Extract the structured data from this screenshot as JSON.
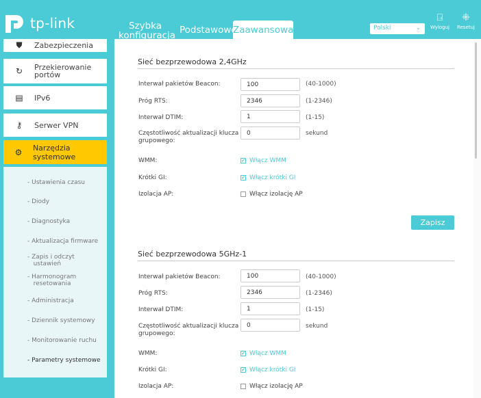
{
  "header": {
    "logo_text": "tp-link",
    "tabs": {
      "quick_line1": "Szybka",
      "quick_line2": "konfiguracja",
      "basic": "Podstawowe",
      "advanced": "Zaawansowane"
    },
    "language": "Polski",
    "logout": "Wyloguj",
    "reset": "Resetuj"
  },
  "sidebar": {
    "items": [
      {
        "label": "Zabezpieczenia",
        "icon": "shield-icon"
      },
      {
        "label_line1": "Przekierowanie",
        "label_line2": "portów",
        "icon": "refresh-icon"
      },
      {
        "label": "IPv6",
        "icon": "ipv6-icon"
      },
      {
        "label": "Serwer VPN",
        "icon": "vpn-key-icon"
      },
      {
        "label": "Narzędzia systemowe",
        "icon": "gear-icon"
      }
    ],
    "submenu": [
      {
        "label": "Ustawienia czasu"
      },
      {
        "label": "Diody"
      },
      {
        "label": "Diagnostyka"
      },
      {
        "label": "Aktualizacja firmware"
      },
      {
        "label_line1": "Zapis i odczyt",
        "label_line2": "ustawień"
      },
      {
        "label_line1": "Harmonogram",
        "label_line2": "resetowania"
      },
      {
        "label": "Administracja"
      },
      {
        "label": "Dziennik systemowy"
      },
      {
        "label": "Monitorowanie ruchu"
      },
      {
        "label": "Parametry systemowe"
      }
    ],
    "submenu_prefix": "-"
  },
  "sections": [
    {
      "title": "Sieć bezprzewodowa 2,4GHz",
      "beacon": {
        "label": "Interwał pakietów Beacon:",
        "value": "100",
        "hint": "(40-1000)"
      },
      "rts": {
        "label": "Próg RTS:",
        "value": "2346",
        "hint": "(1-2346)"
      },
      "dtim": {
        "label": "Interwał DTIM:",
        "value": "1",
        "hint": "(1-15)"
      },
      "gkey": {
        "label_line1": "Częstotliwość aktualizacji klucza",
        "label_line2": "grupowego:",
        "value": "0",
        "hint": "sekund"
      },
      "wmm": {
        "label": "WMM:",
        "option": "Włącz WMM"
      },
      "sgi": {
        "label": "Krótki GI:",
        "option": "Włącz krótki GI"
      },
      "ap": {
        "label": "Izolacja AP:",
        "option": "Włącz izolację AP"
      }
    },
    {
      "title": "Sieć bezprzewodowa 5GHz-1",
      "beacon": {
        "label": "Interwał pakietów Beacon:",
        "value": "100",
        "hint": "(40-1000)"
      },
      "rts": {
        "label": "Próg RTS:",
        "value": "2346",
        "hint": "(1-2346)"
      },
      "dtim": {
        "label": "Interwał DTIM:",
        "value": "1",
        "hint": "(1-15)"
      },
      "gkey": {
        "label_line1": "Częstotliwość aktualizacji klucza",
        "label_line2": "grupowego:",
        "value": "0",
        "hint": "sekund"
      },
      "wmm": {
        "label": "WMM:",
        "option": "Włącz WMM"
      },
      "sgi": {
        "label": "Krótki GI:",
        "option": "Włącz krótki GI"
      },
      "ap": {
        "label": "Izolacja AP:",
        "option": "Włącz izolację AP"
      }
    }
  ],
  "save_label": "Zapisz",
  "colors": {
    "accent": "#4acbd6",
    "active": "#ffc800"
  }
}
